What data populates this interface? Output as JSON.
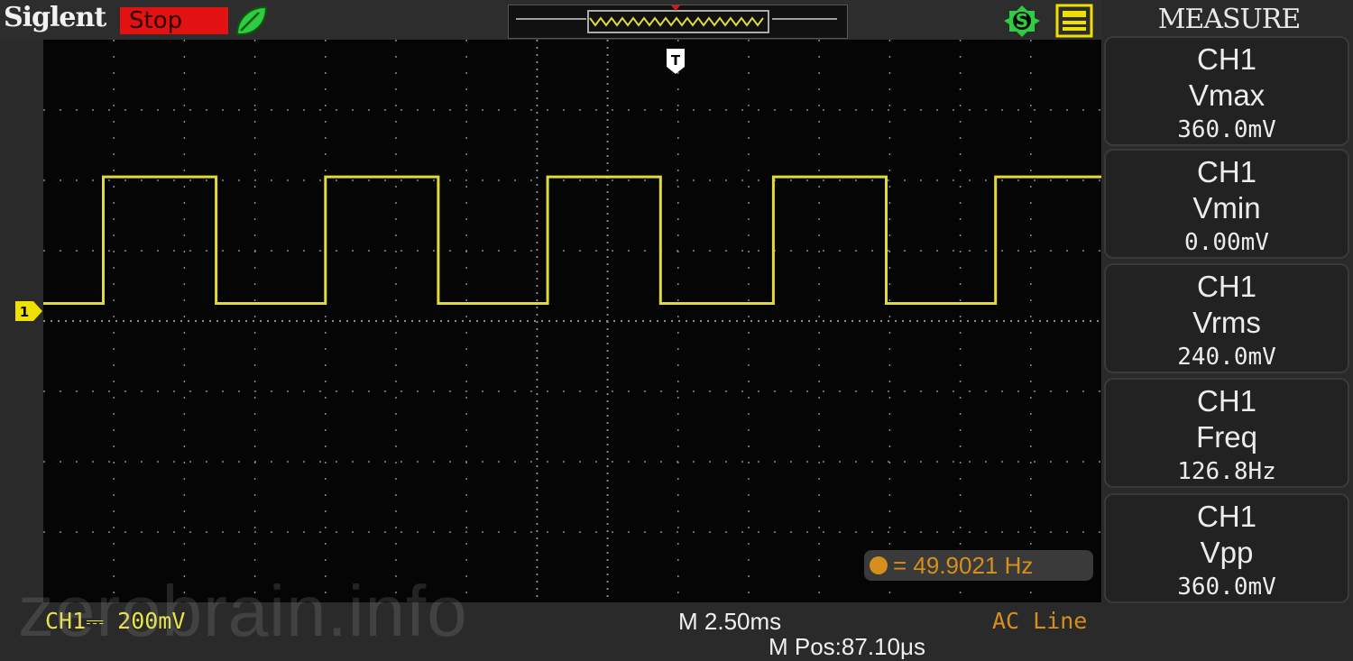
{
  "header": {
    "brand": "Siglent",
    "run_state": "Stop",
    "measure_title": "MEASURE"
  },
  "icons": {
    "pass_icon": "leaf-pass-icon",
    "memory_bar": "waveform-memory-icon",
    "s_icon": "s-circle-icon",
    "usb_icon": "usb-storage-icon",
    "trigger_marker": "trigger-t-icon",
    "channel_marker": "ch1-marker-icon"
  },
  "colors": {
    "trace": "#e2d93a",
    "stop": "#e31212",
    "accent_green": "#2ecc40",
    "accent_yellow": "#f0e000",
    "trigger_orange": "#d58f1a"
  },
  "channel_marker_label": "1",
  "trigger_marker_label": "T",
  "measurements": [
    {
      "channel": "CH1",
      "param": "Vmax",
      "value": "360.0mV"
    },
    {
      "channel": "CH1",
      "param": "Vmin",
      "value": "0.00mV"
    },
    {
      "channel": "CH1",
      "param": "Vrms",
      "value": "240.0mV"
    },
    {
      "channel": "CH1",
      "param": "Freq",
      "value": "126.8Hz"
    },
    {
      "channel": "CH1",
      "param": "Vpp",
      "value": "360.0mV"
    }
  ],
  "trigger_freq": "= 49.9021 Hz",
  "status": {
    "ch1_scale": "CH1⎓ 200mV",
    "timebase": "M 2.50ms",
    "position": "M Pos:87.10μs",
    "trigger_source": "AC Line"
  },
  "watermark": "zerobrain.info",
  "chart_data": {
    "type": "line",
    "series": [
      {
        "shape": "square-wave",
        "low_mV": 0,
        "high_mV": 360,
        "x_div": [
          0,
          0.85,
          0.85,
          2.45,
          2.45,
          4.0,
          4.0,
          5.6,
          5.6,
          7.15,
          7.15,
          8.75,
          8.75,
          10.35,
          10.35,
          11.95,
          11.95,
          13.5,
          13.5,
          15.2
        ],
        "y_mV": [
          0,
          0,
          360,
          360,
          0,
          0,
          360,
          360,
          0,
          0,
          360,
          360,
          0,
          0,
          360,
          360,
          0,
          0,
          360,
          360
        ]
      }
    ],
    "x_divisions": 15,
    "y_divisions": 8,
    "volts_per_div_mV": 200,
    "time_per_div_ms": 2.5,
    "ground_div_from_top": 3.75,
    "grid": true
  }
}
